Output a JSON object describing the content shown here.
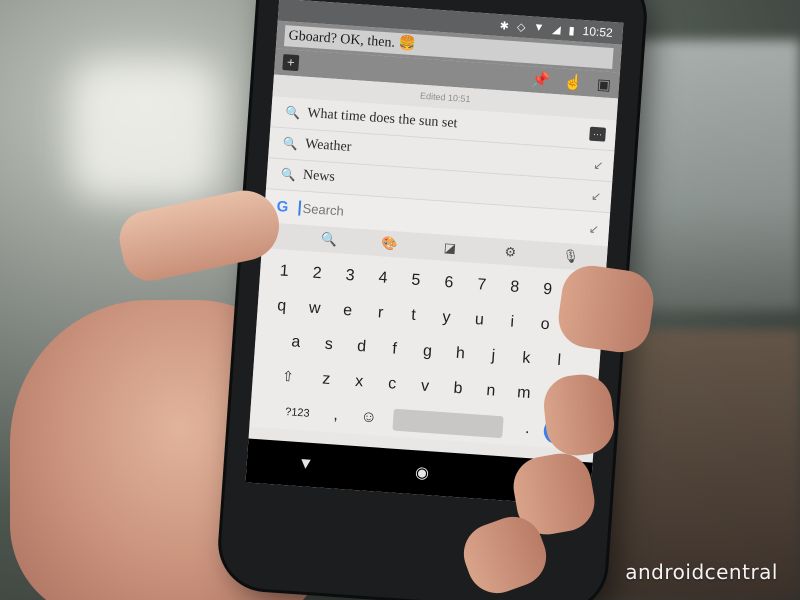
{
  "status_bar": {
    "time": "10:52",
    "icons": [
      "bluetooth-icon",
      "nfc-icon",
      "wifi-icon",
      "signal-icon",
      "battery-icon"
    ]
  },
  "note": {
    "title": "Gboard? OK, then. 🍔",
    "edited": "Edited 10:51"
  },
  "suggestions": [
    {
      "text": "What time does the sun set",
      "type": "search"
    },
    {
      "text": "Weather",
      "type": "search"
    },
    {
      "text": "News",
      "type": "search"
    }
  ],
  "search": {
    "placeholder": "Search",
    "engine": "G"
  },
  "keyboard": {
    "numbers": [
      "1",
      "2",
      "3",
      "4",
      "5",
      "6",
      "7",
      "8",
      "9",
      "0"
    ],
    "row1": [
      "q",
      "w",
      "e",
      "r",
      "t",
      "y",
      "u",
      "i",
      "o",
      "p"
    ],
    "row2": [
      "a",
      "s",
      "d",
      "f",
      "g",
      "h",
      "j",
      "k",
      "l"
    ],
    "row3": [
      "z",
      "x",
      "c",
      "v",
      "b",
      "n",
      "m"
    ],
    "symbols_label": "?123",
    "comma": ",",
    "period": "."
  },
  "watermark": "androidcentral",
  "colors": {
    "accent": "#3c7fe6",
    "status_bar": "#5f6061",
    "note_bar": "#8a8a8a"
  }
}
